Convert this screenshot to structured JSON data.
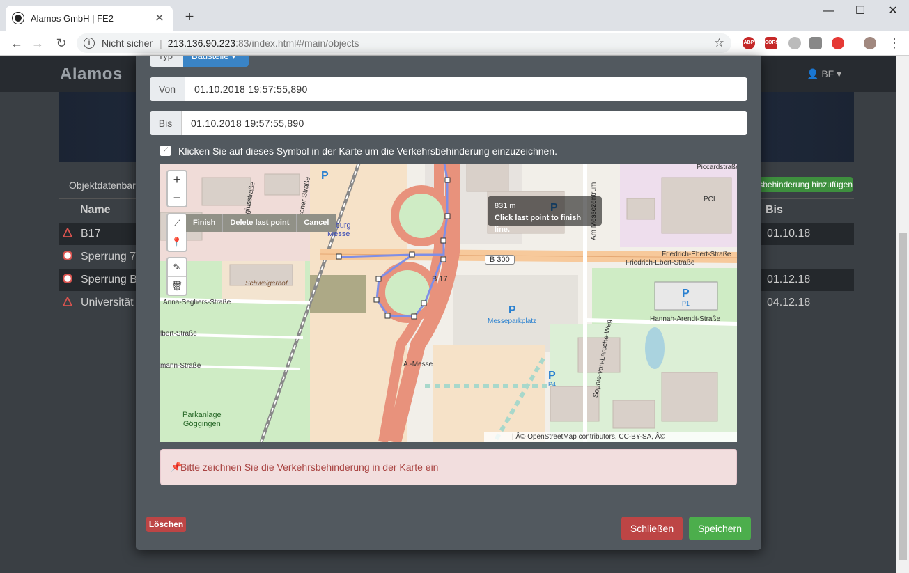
{
  "browser": {
    "tab_title": "Alamos GmbH | FE2",
    "tab_close": "✕",
    "new_tab": "+",
    "security_label": "Nicht sicher",
    "url_host": "213.136.90.223",
    "url_rest": ":83/index.html#/main/objects",
    "extensions": [
      "ABP",
      "CORS"
    ]
  },
  "app": {
    "logo": "Alamos",
    "user": "BF ▾",
    "tab_label": "Objektdatenbar",
    "add_button": "Verkehrsbehinderung hinzufügen",
    "columns": {
      "name": "Name",
      "to": "Bis"
    },
    "rows": [
      {
        "name": "B17",
        "to": "01.10.18",
        "icon": "warning-icon",
        "dark": true
      },
      {
        "name": "Sperrung 7",
        "to": "",
        "icon": "blocked-icon",
        "dark": false
      },
      {
        "name": "Sperrung B",
        "to": "01.12.18",
        "icon": "blocked-icon",
        "dark": true
      },
      {
        "name": "Universität",
        "to": "04.12.18",
        "icon": "warning-icon",
        "dark": false
      }
    ]
  },
  "modal": {
    "type_label": "Typ",
    "type_value": "Baustelle ▾",
    "from_label": "Von",
    "from_value": "01.10.2018 19:57:55,890",
    "to_label": "Bis",
    "to_value": "01.10.2018 19:57:55,890",
    "hint": "Klicken Sie auf dieses Symbol in der Karte um die Verkehrsbehinderung einzuzeichnen.",
    "map": {
      "zoom_in": "+",
      "zoom_out": "−",
      "actions": {
        "finish": "Finish",
        "delete_last": "Delete last point",
        "cancel": "Cancel"
      },
      "tooltip_distance": "831 m",
      "tooltip_hint": "Click last point to finish line.",
      "attribution": "| Â© OpenStreetMap contributors, CC-BY-SA, Â©",
      "labels": {
        "b300": "B 300",
        "b17": "B 17",
        "messe": "gsburg\nMesse",
        "schweigerhof": "Schweigerhof",
        "anna": "Anna-Seghers-Straße",
        "albert": "lbert-Straße",
        "mann": "mann-Straße",
        "parkanlage": "Parkanlage\nGöggingen",
        "messeparkplatz": "Messeparkplatz",
        "pci": "PCI",
        "febert1": "Friedrich-Ebert-Straße",
        "febert2": "Friedrich-Ebert-Straße",
        "hannah": "Hannah-Arendt-Straße",
        "sophie": "Sophie-von-Laroche-Weg",
        "amessezentrum": "Am Messezentrum",
        "amesse": "A.-Messe",
        "piccard": "Piccardstraße",
        "bergius": "ergiusstraße",
        "sener": "sener Straße",
        "p": "P",
        "p1": "P1",
        "p4": "P4"
      }
    },
    "alert": "Bitte zeichnen Sie die Verkehrsbehinderung in der Karte ein",
    "delete_button": "Löschen",
    "close_button": "Schließen",
    "save_button": "Speichern"
  }
}
